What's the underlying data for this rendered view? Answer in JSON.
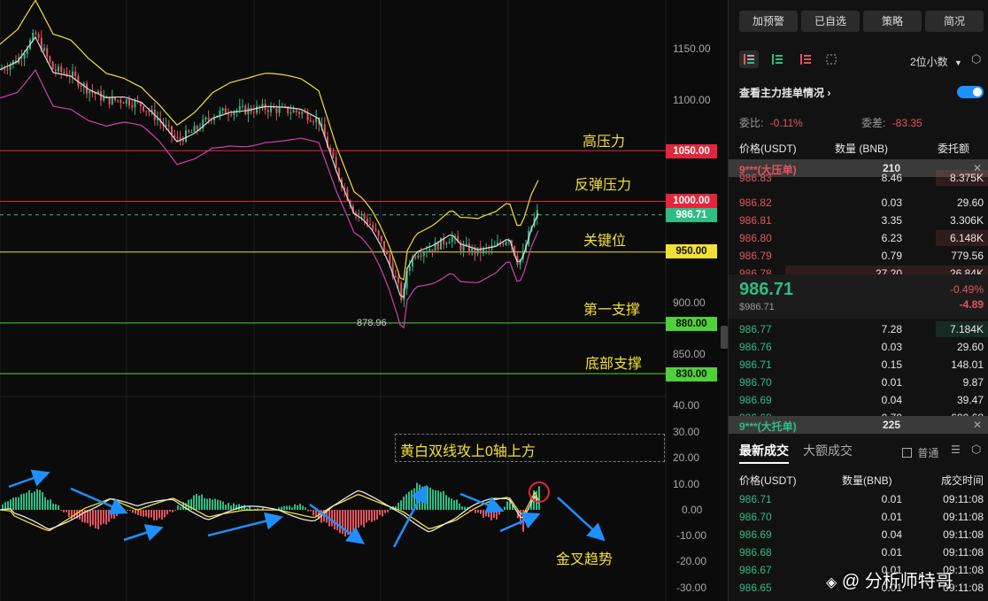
{
  "chart": {
    "y_axis_labels": [
      "1150.00",
      "1100.00",
      "900.00",
      "850.00",
      "40.00",
      "30.00",
      "20.00",
      "10.00",
      "0.00",
      "-10.00",
      "-20.00",
      "-30.00"
    ],
    "levels": [
      {
        "label": "高压力",
        "price": "1050.00",
        "color": "#e3273a",
        "tag_bg": "#e3273a",
        "tag_fg": "#ffffff"
      },
      {
        "label": "反弹压力",
        "price": "1000.00",
        "color": "#e3273a",
        "tag_bg": "#e3273a",
        "tag_fg": "#ffffff"
      },
      {
        "label": "关键位",
        "price": "950.00",
        "color": "#f3e034",
        "tag_bg": "#f3e034",
        "tag_fg": "#111111"
      },
      {
        "label": "第一支撑",
        "price": "880.00",
        "color": "#4fd13a",
        "tag_bg": "#4fd13a",
        "tag_fg": "#111111"
      },
      {
        "label": "底部支撑",
        "price": "830.00",
        "color": "#4fd13a",
        "tag_bg": "#4fd13a",
        "tag_fg": "#111111"
      }
    ],
    "current_price_tag": "986.71",
    "low_marker": "878.96",
    "note_box": "黄白双线攻上0轴上方",
    "golden_cross": "金叉趋势"
  },
  "panel": {
    "top_buttons": [
      "加预警",
      "已自选",
      "策略",
      "简况"
    ],
    "decimal_select": "2位小数",
    "order_toggle_label": "查看主力挂单情况",
    "commission_ratio_label": "委比:",
    "commission_ratio_value": "-0.11%",
    "commission_diff_label": "委差:",
    "commission_diff_value": "-83.35",
    "book_headers": [
      "价格(USDT)",
      "数量 (BNB)",
      "委托额"
    ],
    "big_ask": {
      "label": "9***(大压单)",
      "qty": "210"
    },
    "asks": [
      {
        "price": "986.83",
        "qty": "8.46",
        "total": "8.375K"
      },
      {
        "price": "986.82",
        "qty": "0.03",
        "total": "29.60"
      },
      {
        "price": "986.81",
        "qty": "3.35",
        "total": "3.306K"
      },
      {
        "price": "986.80",
        "qty": "6.23",
        "total": "6.148K"
      },
      {
        "price": "986.79",
        "qty": "0.79",
        "total": "779.56"
      },
      {
        "price": "986.78",
        "qty": "27.20",
        "total": "26.84K"
      }
    ],
    "last_price": "986.71",
    "last_price_usd": "$986.71",
    "change_pct": "-0.49%",
    "change_abs": "-4.89",
    "bids": [
      {
        "price": "986.77",
        "qty": "7.28",
        "total": "7.184K"
      },
      {
        "price": "986.76",
        "qty": "0.03",
        "total": "29.60"
      },
      {
        "price": "986.71",
        "qty": "0.15",
        "total": "148.01"
      },
      {
        "price": "986.70",
        "qty": "0.01",
        "total": "9.87"
      },
      {
        "price": "986.69",
        "qty": "0.04",
        "total": "39.47"
      },
      {
        "price": "986.68",
        "qty": "0.70",
        "total": "690.68"
      }
    ],
    "big_bid": {
      "label": "9***(大托单)",
      "qty": "225"
    },
    "trade_tabs": [
      "最新成交",
      "大额成交"
    ],
    "normal_label": "普通",
    "trade_headers": [
      "价格(USDT)",
      "数量(BNB)",
      "成交时间"
    ],
    "trades": [
      {
        "price": "986.71",
        "qty": "0.01",
        "time": "09:11:08"
      },
      {
        "price": "986.70",
        "qty": "0.01",
        "time": "09:11:08"
      },
      {
        "price": "986.69",
        "qty": "0.04",
        "time": "09:11:08"
      },
      {
        "price": "986.68",
        "qty": "0.01",
        "time": "09:11:08"
      },
      {
        "price": "986.67",
        "qty": "0.01",
        "time": "09:11:08"
      },
      {
        "price": "986.65",
        "qty": "0.01",
        "time": "09:11:08"
      }
    ],
    "watermark": "分析师特哥"
  },
  "colors": {
    "up": "#2ebd85",
    "down": "#e4555e",
    "yellow": "#f3e034",
    "accent": "#1e90ff"
  }
}
